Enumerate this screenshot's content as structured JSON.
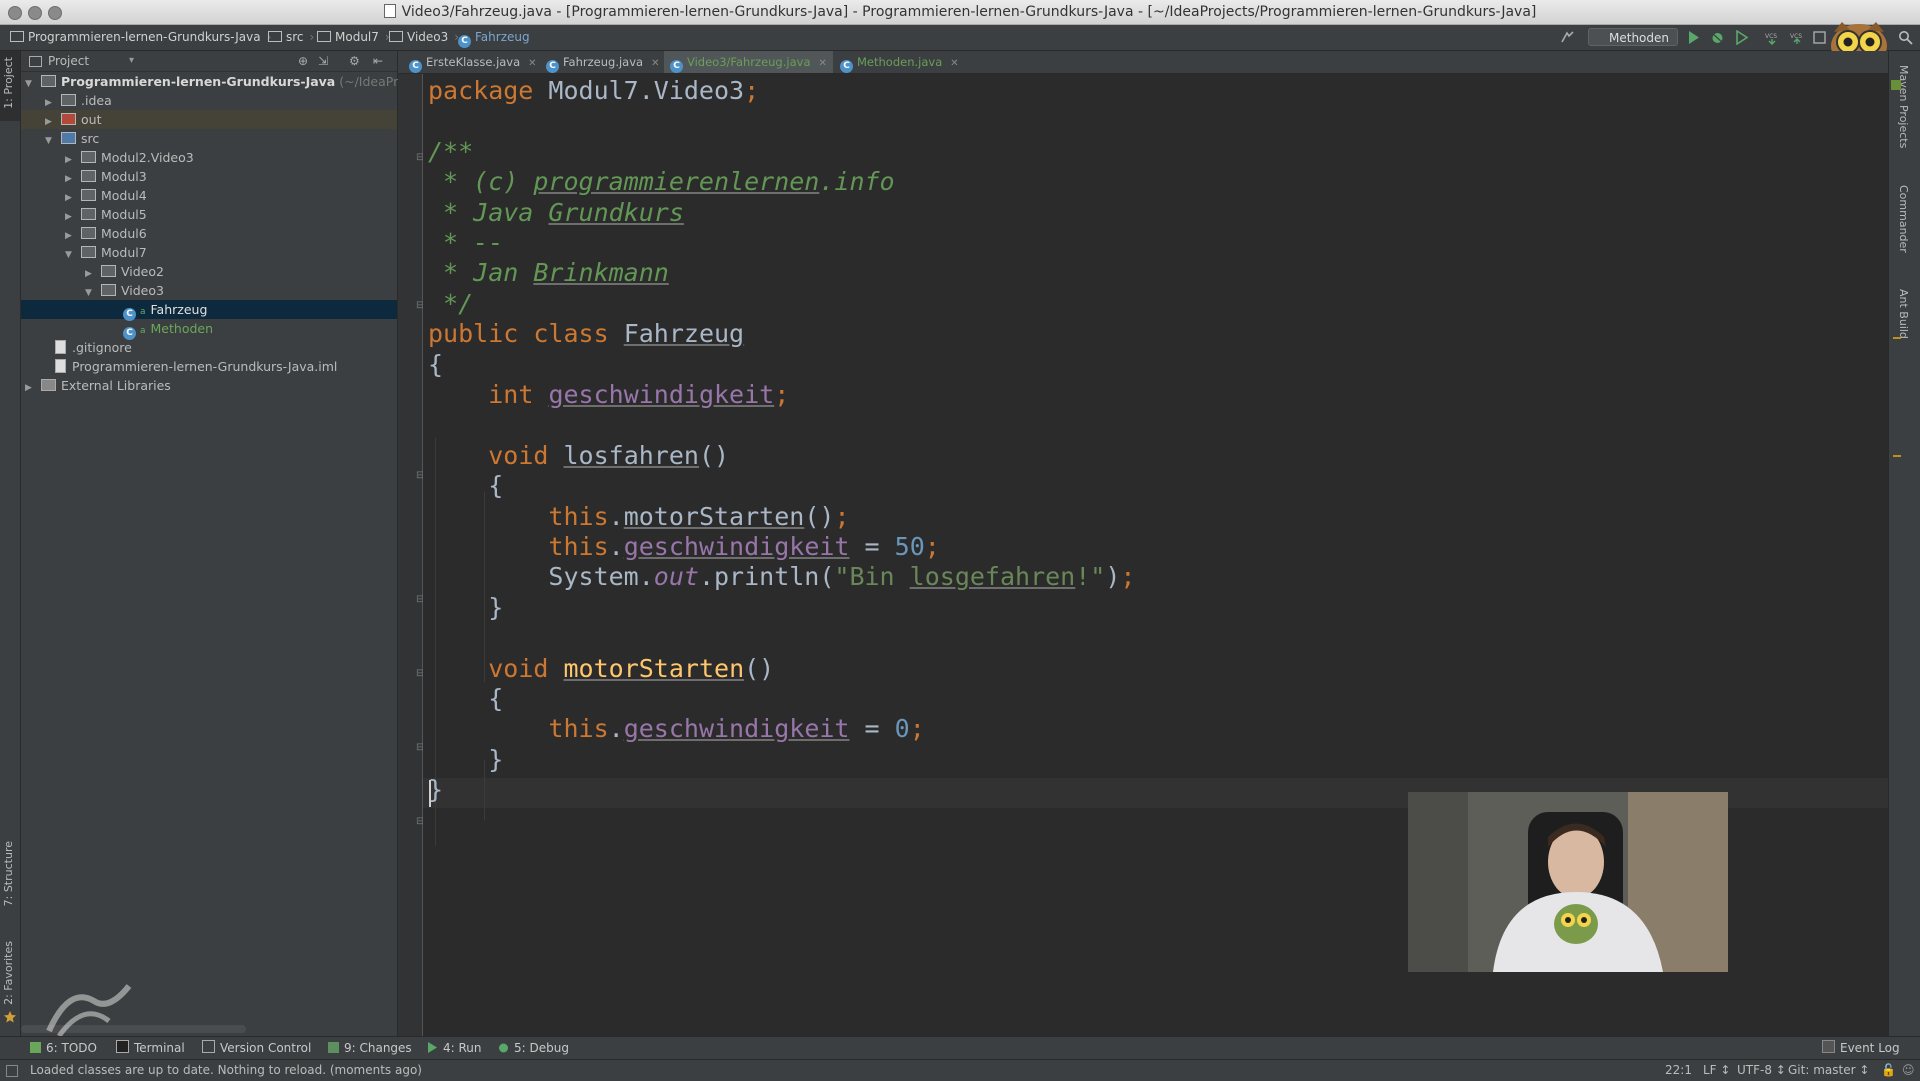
{
  "window": {
    "title": "Video3/Fahrzeug.java - [Programmieren-lernen-Grundkurs-Java] - Programmieren-lernen-Grundkurs-Java - [~/IdeaProjects/Programmieren-lernen-Grundkurs-Java]"
  },
  "breadcrumb": {
    "items": [
      "Programmieren-lernen-Grundkurs-Java",
      "src",
      "Modul7",
      "Video3",
      "Fahrzeug"
    ]
  },
  "toolbar": {
    "run_config": "Methoden",
    "icons": [
      "run-icon",
      "debug-icon",
      "coverage-icon",
      "vcs-update-icon",
      "vcs-commit-icon",
      "search-icon"
    ]
  },
  "left_stripe": {
    "project_tab": "1: Project",
    "structure_tab": "7: Structure",
    "favorites_tab": "2: Favorites"
  },
  "project_panel": {
    "header": "Project",
    "tree": [
      {
        "label": "Programmieren-lernen-Grundkurs-Java",
        "suffix": "(~/IdeaProject",
        "expanded": true
      },
      {
        "label": ".idea",
        "expanded": false
      },
      {
        "label": "out",
        "expanded": false
      },
      {
        "label": "src",
        "expanded": true
      },
      {
        "label": "Modul2.Video3",
        "expanded": false
      },
      {
        "label": "Modul3",
        "expanded": false
      },
      {
        "label": "Modul4",
        "expanded": false
      },
      {
        "label": "Modul5",
        "expanded": false
      },
      {
        "label": "Modul6",
        "expanded": false
      },
      {
        "label": "Modul7",
        "expanded": true
      },
      {
        "label": "Video2",
        "expanded": false
      },
      {
        "label": "Video3",
        "expanded": true
      },
      {
        "label": "Fahrzeug",
        "selected": true
      },
      {
        "label": "Methoden"
      },
      {
        "label": ".gitignore"
      },
      {
        "label": "Programmieren-lernen-Grundkurs-Java.iml"
      },
      {
        "label": "External Libraries",
        "expanded": false
      }
    ]
  },
  "tabs": [
    {
      "label": "ErsteKlasse.java",
      "active": false
    },
    {
      "label": "Fahrzeug.java",
      "active": false
    },
    {
      "label": "Video3/Fahrzeug.java",
      "active": true
    },
    {
      "label": "Methoden.java",
      "active": false
    }
  ],
  "editor": {
    "cursor_line": 22,
    "lines": [
      "package Modul7.Video3;",
      "",
      "/**",
      " * (c) programmierenlernen.info",
      " * Java Grundkurs",
      " * --",
      " * Jan Brinkmann",
      " */",
      "public class Fahrzeug",
      "{",
      "    int geschwindigkeit;",
      "",
      "    void losfahren()",
      "    {",
      "        this.motorStarten();",
      "        this.geschwindigkeit = 50;",
      "        System.out.println(\"Bin losgefahren!\");",
      "    }",
      "",
      "    void motorStarten()",
      "    {",
      "        this.geschwindigkeit = 0;",
      "    }",
      "}"
    ]
  },
  "right_stripe": {
    "maven_tab": "Maven Projects",
    "commander_tab": "Commander",
    "ant_tab": "Ant Build"
  },
  "bottom_bar": {
    "todo": "6: TODO",
    "terminal": "Terminal",
    "version_control": "Version Control",
    "changes": "9: Changes",
    "run": "4: Run",
    "debug": "5: Debug",
    "event_log": "Event Log"
  },
  "status_bar": {
    "message": "Loaded classes are up to date. Nothing to reload. (moments ago)",
    "position": "22:1",
    "line_separator": "LF ↕",
    "encoding": "UTF-8 ↕",
    "git_branch": "Git: master ↕"
  },
  "colors": {
    "keyword": "#cc7832",
    "comment": "#629755",
    "field": "#9876aa",
    "number": "#6897bb",
    "string": "#6a8759",
    "method": "#ffc66d",
    "selection": "#0d293e"
  }
}
